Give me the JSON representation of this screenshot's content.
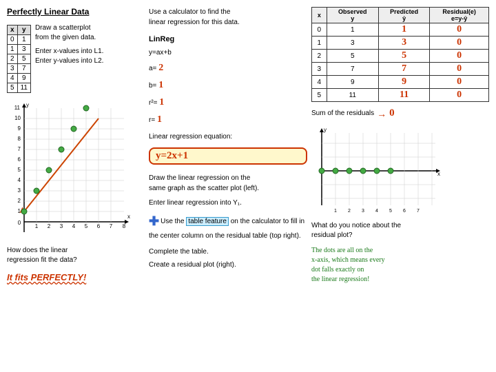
{
  "title": "Perfectly Linear Data",
  "left": {
    "draw_text": "Draw a scatterplot\nfrom the given data.",
    "enter_text": "Enter x-values into L1.\nEnter y-values into L2.",
    "data_table": {
      "headers": [
        "x",
        "y"
      ],
      "rows": [
        [
          "0",
          "1"
        ],
        [
          "1",
          "3"
        ],
        [
          "2",
          "5"
        ],
        [
          "3",
          "7"
        ],
        [
          "4",
          "9"
        ],
        [
          "5",
          "11"
        ]
      ]
    },
    "how_text": "How does the linear\nregression fit the data?",
    "perfectly_text": "It fits PERFECTLY!"
  },
  "mid": {
    "use_calc_text": "Use a calculator to find the\nlinear regression for this data.",
    "linreg_label": "LinReg",
    "y_eq": "y=ax+b",
    "a_label": "a=",
    "a_val": "2",
    "b_label": "b=",
    "b_val": "1",
    "r2_label": "r²=",
    "r2_val": "1",
    "r_label": "r=",
    "r_val": "1",
    "lin_reg_eq_label": "Linear regression equation:",
    "lin_reg_eq": "y=2x+1",
    "draw_lin_text": "Draw the linear regression on the\nsame graph as the scatter plot (left).",
    "enter_lin_text": "Enter linear regression into Y₁.",
    "use_table_text": "Use the table feature on the\ncalculator to fill in the center\ncolumn on the residual table (top\nright).",
    "table_highlight": "table feature",
    "complete_text": "Complete the table.",
    "create_text": "Create a residual plot (right)."
  },
  "right": {
    "residual_table": {
      "headers": [
        "x",
        "Observed\nŷ",
        "Predicted\nŷ",
        "Residual(e)\ne=y-ŷ"
      ],
      "rows": [
        [
          "0",
          "1",
          "1",
          "0"
        ],
        [
          "1",
          "3",
          "3",
          "0"
        ],
        [
          "2",
          "5",
          "5",
          "0"
        ],
        [
          "3",
          "7",
          "7",
          "0"
        ],
        [
          "4",
          "9",
          "9",
          "0"
        ],
        [
          "5",
          "11",
          "11",
          "0"
        ]
      ]
    },
    "sum_label": "Sum of the residuals",
    "sum_val": "0",
    "what_notice": "What do you notice about the\nresidual plot?",
    "answer": "The dots are all on the\nx-axis, which means every\ndot falls exactly on\nthe linear regression!"
  }
}
